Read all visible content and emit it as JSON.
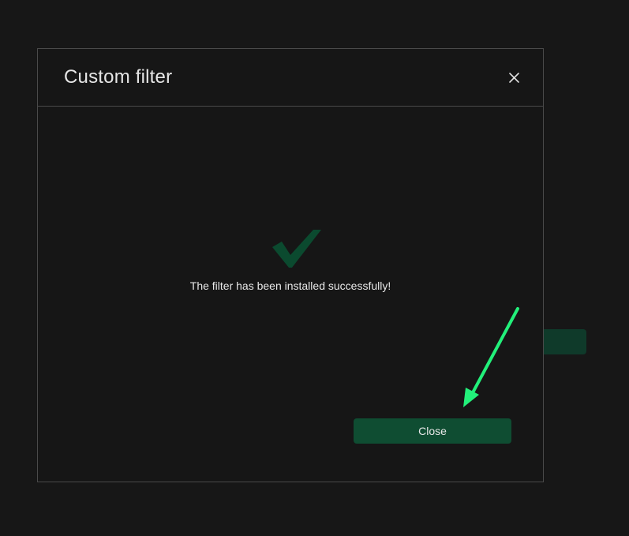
{
  "dialog": {
    "title": "Custom filter",
    "close_icon": "close-icon",
    "success_icon": "checkmark-icon",
    "message": "The filter has been installed successfully!",
    "close_button_label": "Close"
  },
  "annotation": {
    "arrow_icon": "arrow-annotation-icon",
    "arrow_color": "#22f07a"
  },
  "colors": {
    "background": "#171717",
    "dialog_background": "#161616",
    "border": "#4a4a4a",
    "accent": "#0f4d32",
    "check": "#0b4a2f"
  }
}
